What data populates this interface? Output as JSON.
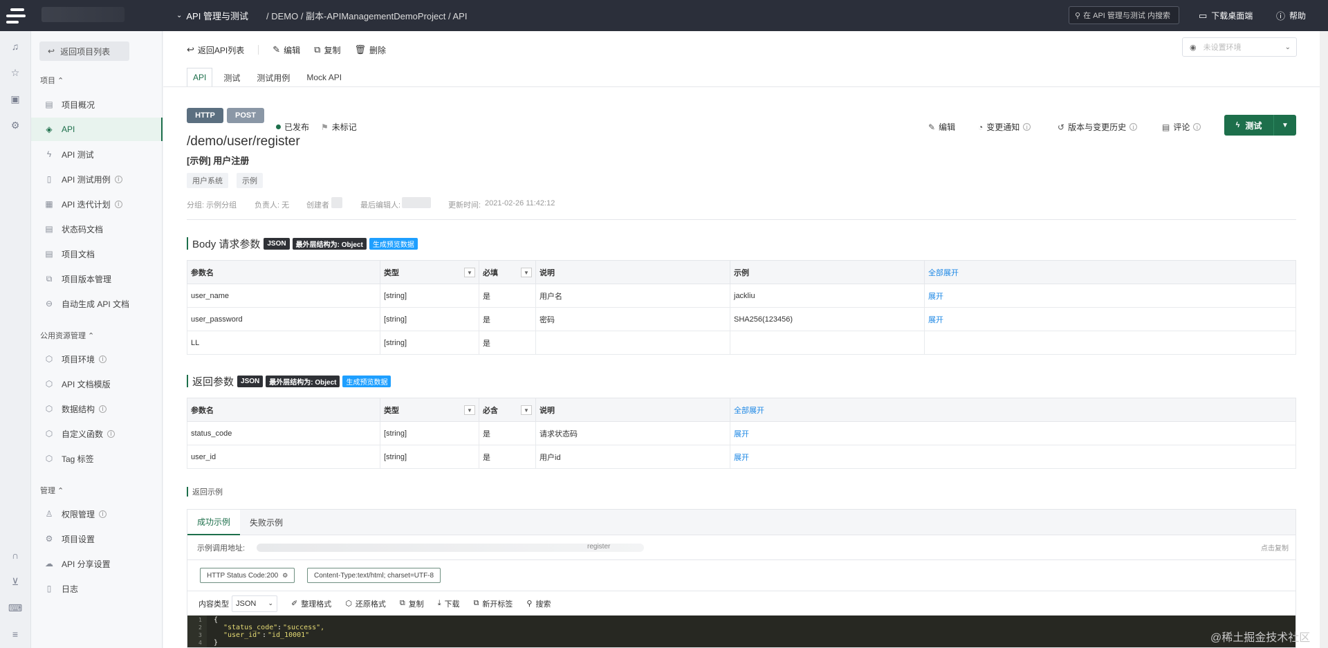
{
  "topbar": {
    "module": "API 管理与测试",
    "breadcrumb": "/ DEMO / 副本-APIManagementDemoProject / API",
    "search_placeholder": "在 API 管理与测试 内搜索",
    "download": "下载桌面端",
    "help": "帮助"
  },
  "sidebar": {
    "back": "返回项目列表",
    "section_project": "项目",
    "items_project": [
      {
        "label": "项目概况",
        "icon": "overview-icon"
      },
      {
        "label": "API",
        "icon": "api-tag-icon"
      },
      {
        "label": "API 测试",
        "icon": "bolt-icon"
      },
      {
        "label": "API 测试用例",
        "icon": "clipboard-icon"
      },
      {
        "label": "API 迭代计划",
        "icon": "calendar-icon"
      },
      {
        "label": "状态码文档",
        "icon": "doc-icon"
      },
      {
        "label": "项目文档",
        "icon": "book-icon"
      },
      {
        "label": "项目版本管理",
        "icon": "versions-icon"
      },
      {
        "label": "自动生成 API 文档",
        "icon": "robot-icon"
      }
    ],
    "section_public": "公用资源管理",
    "items_public": [
      {
        "label": "项目环境",
        "icon": "cube-icon"
      },
      {
        "label": "API 文档模版",
        "icon": "cube-icon"
      },
      {
        "label": "数据结构",
        "icon": "cube-icon"
      },
      {
        "label": "自定义函数",
        "icon": "cube-icon"
      },
      {
        "label": "Tag 标签",
        "icon": "cube-icon"
      }
    ],
    "section_manage": "管理",
    "items_manage": [
      {
        "label": "权限管理",
        "icon": "user-icon"
      },
      {
        "label": "项目设置",
        "icon": "settings-icon"
      },
      {
        "label": "API 分享设置",
        "icon": "cloud-icon"
      },
      {
        "label": "日志",
        "icon": "log-icon"
      }
    ]
  },
  "toolbar": {
    "back": "返回API列表",
    "edit": "编辑",
    "copy": "复制",
    "delete": "删除",
    "env_placeholder": "未设置环境"
  },
  "tabs": [
    "API",
    "测试",
    "测试用例",
    "Mock API"
  ],
  "api": {
    "protocol": "HTTP",
    "method": "POST",
    "status": "已发布",
    "mark": "未标记",
    "path": "/demo/user/register",
    "name": "[示例] 用户注册",
    "tags": [
      "用户系统",
      "示例"
    ],
    "meta": {
      "group": "分组: 示例分组",
      "owner": "负责人: 无",
      "creator": "创建者",
      "last_editor": "最后编辑人:",
      "updated": "更新时间:",
      "updated_value": "2021-02-26 11:42:12"
    },
    "actions": {
      "edit": "编辑",
      "notify": "变更通知",
      "history": "版本与变更历史",
      "comment": "评论",
      "test": "测试"
    }
  },
  "body_params": {
    "title": "Body 请求参数",
    "format": "JSON",
    "outer": "最外层结构为: Object",
    "gen": "生成预览数据",
    "headers": {
      "name": "参数名",
      "type": "类型",
      "required": "必填",
      "desc": "说明",
      "example": "示例",
      "expand_all": "全部展开"
    },
    "rows": [
      {
        "name": "user_name",
        "type": "[string]",
        "required": "是",
        "desc": "用户名",
        "example": "jackliu",
        "action": "展开"
      },
      {
        "name": "user_password",
        "type": "[string]",
        "required": "是",
        "desc": "密码",
        "example": "SHA256(123456)",
        "action": "展开"
      },
      {
        "name": "LL",
        "type": "[string]",
        "required": "是",
        "desc": "",
        "example": "",
        "action": ""
      }
    ]
  },
  "return_params": {
    "title": "返回参数",
    "format": "JSON",
    "outer": "最外层结构为: Object",
    "gen": "生成预览数据",
    "headers": {
      "name": "参数名",
      "type": "类型",
      "required": "必含",
      "desc": "说明",
      "expand_all": "全部展开"
    },
    "rows": [
      {
        "name": "status_code",
        "type": "[string]",
        "required": "是",
        "desc": "请求状态码",
        "action": "展开"
      },
      {
        "name": "user_id",
        "type": "[string]",
        "required": "是",
        "desc": "用户id",
        "action": "展开"
      }
    ]
  },
  "return_example": {
    "title": "返回示例",
    "tabs": [
      "成功示例",
      "失败示例"
    ],
    "url_label": "示例调用地址:",
    "url_tail": "register",
    "copy": "点击复制",
    "status_chip": "HTTP Status Code:200",
    "content_chip": "Content-Type:text/html; charset=UTF-8",
    "content_type_label": "内容类型",
    "content_type": "JSON",
    "tools": [
      "整理格式",
      "还原格式",
      "复制",
      "下载",
      "新开标签",
      "搜索"
    ],
    "code": {
      "line1": "{",
      "key1": "\"status_code\"",
      "val1": "\"success\",",
      "key2": "\"user_id\"",
      "val2": "\"id_10001\"",
      "line4": "}"
    }
  },
  "watermark": "@稀土掘金技术社区"
}
